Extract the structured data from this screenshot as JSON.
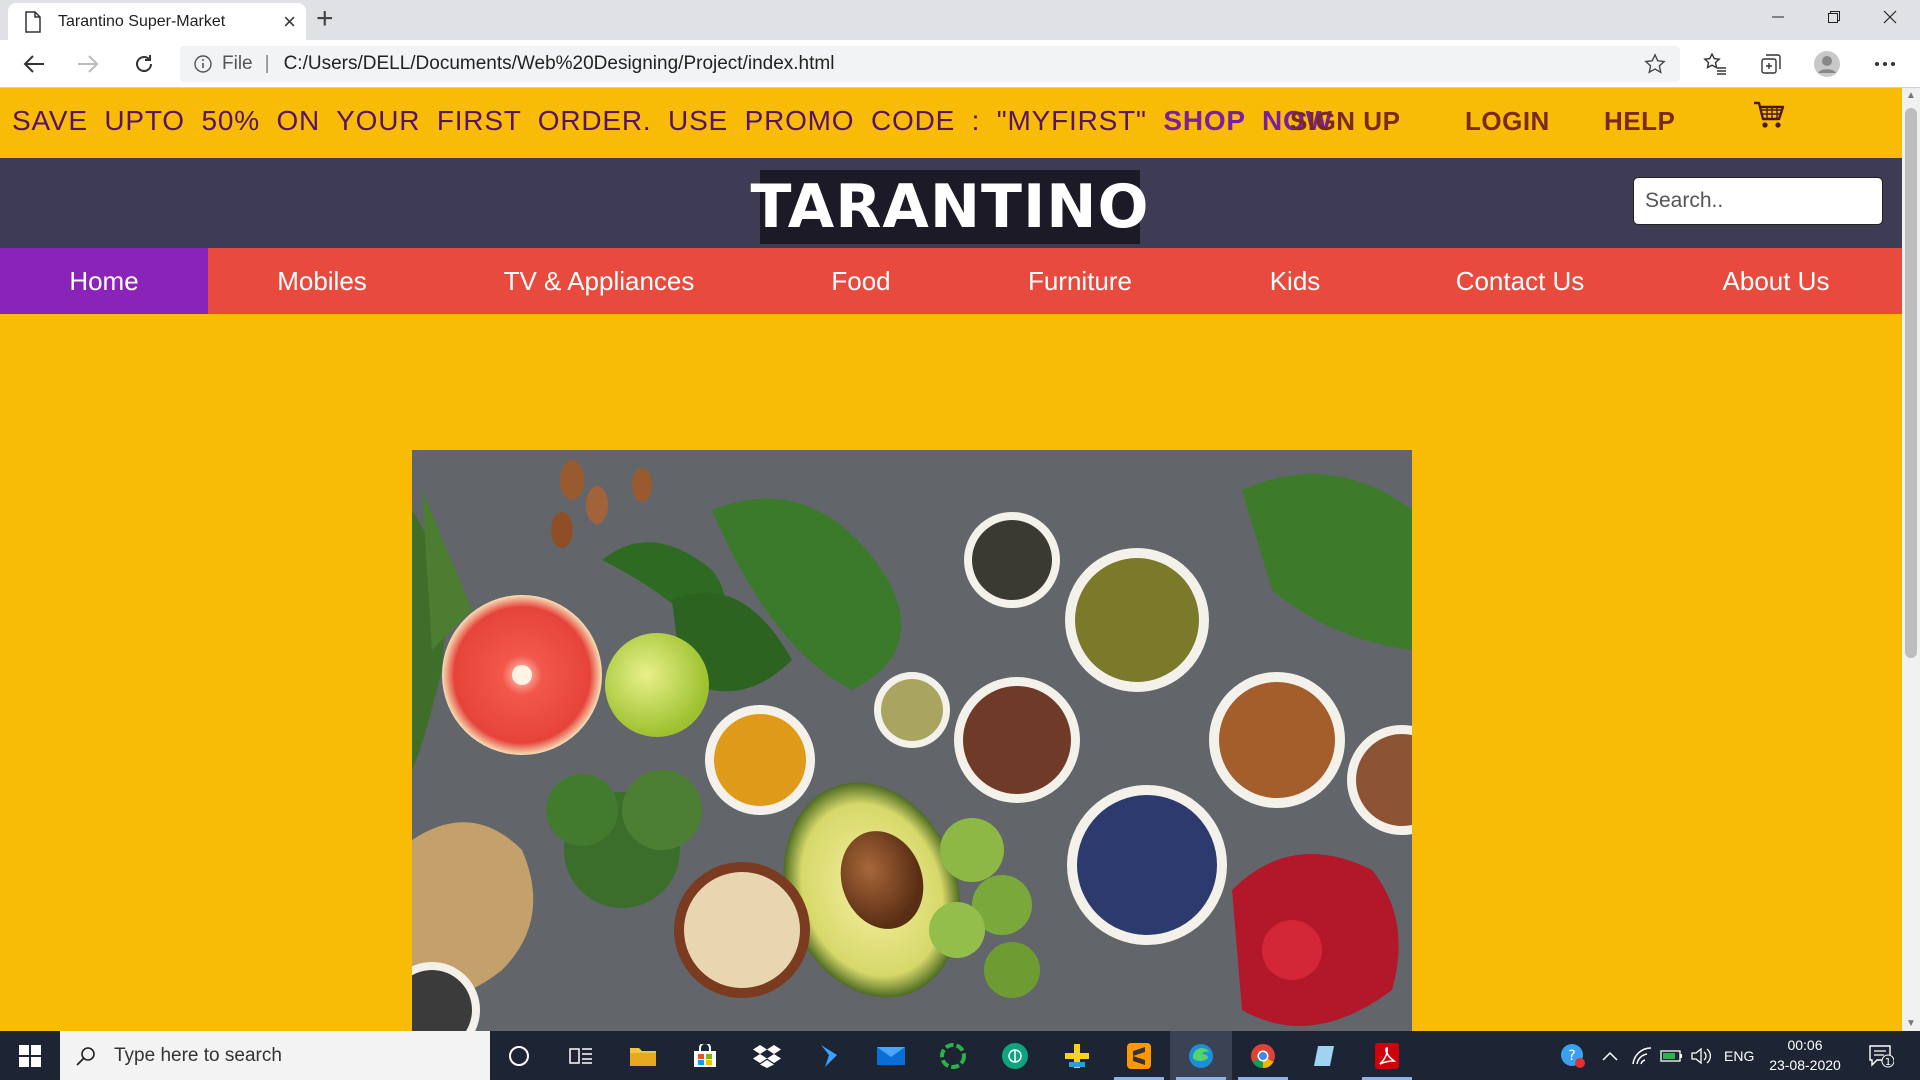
{
  "browser": {
    "tab_title": "Tarantino Super-Market",
    "omnibox_scheme": "File",
    "omnibox_url": "C:/Users/DELL/Documents/Web%20Designing/Project/index.html"
  },
  "promo": {
    "text": "SAVE UPTO 50% ON YOUR FIRST ORDER. USE PROMO CODE : \"MYFIRST\"",
    "shop_now": "SHOP NOW"
  },
  "top_links": {
    "signup": "SIGN UP",
    "login": "LOGIN",
    "help": "HELP"
  },
  "brand": {
    "logo": "TARANTINO"
  },
  "search": {
    "placeholder": "Search.."
  },
  "nav": {
    "items": [
      {
        "label": "Home",
        "active": true
      },
      {
        "label": "Mobiles"
      },
      {
        "label": "TV & Appliances"
      },
      {
        "label": "Food"
      },
      {
        "label": "Furniture"
      },
      {
        "label": "Kids"
      },
      {
        "label": "Contact Us"
      },
      {
        "label": "About Us"
      }
    ]
  },
  "hero": {
    "icon": "food-bowls-image"
  },
  "colors": {
    "promo_bg": "#f9bc06",
    "brand_bg": "#3e3b55",
    "nav_bg": "#e84a3e",
    "nav_active": "#8a23b8",
    "promo_text": "#58126a"
  },
  "taskbar": {
    "search_placeholder": "Type here to search",
    "lang": "ENG",
    "time": "00:06",
    "date": "23-08-2020",
    "notification_count": "1"
  }
}
